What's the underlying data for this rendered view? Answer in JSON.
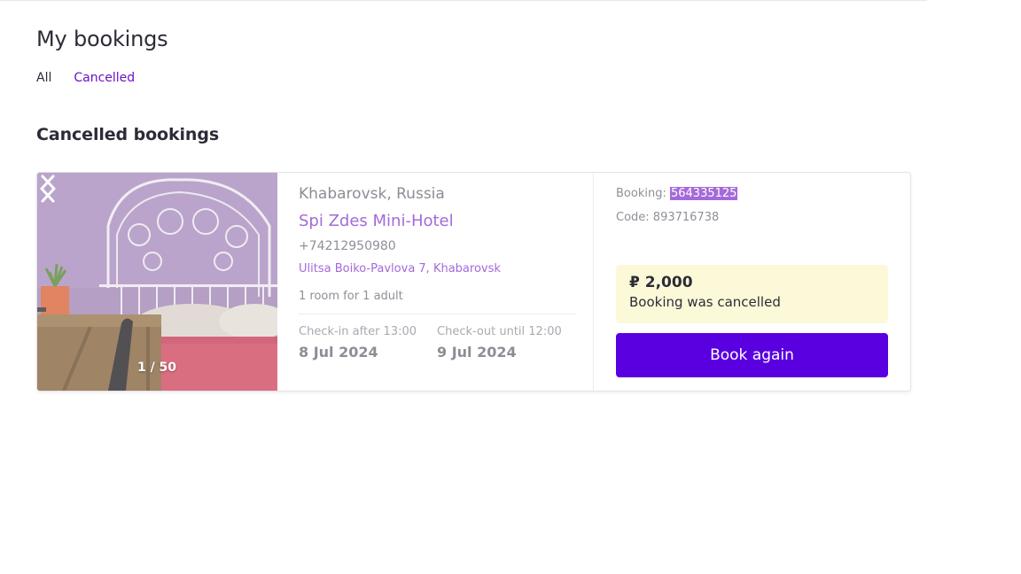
{
  "page": {
    "title": "My bookings",
    "tabs": [
      {
        "label": "All",
        "active": false
      },
      {
        "label": "Cancelled",
        "active": true
      }
    ],
    "section_title": "Cancelled bookings"
  },
  "booking": {
    "photo": {
      "counter": "1 / 50",
      "prev_icon": "chevron-left-icon",
      "next_icon": "chevron-right-icon"
    },
    "city": "Khabarovsk, Russia",
    "hotel_name": "Spi Zdes Mini-Hotel",
    "phone": "+74212950980",
    "address": "Ulitsa Boiko-Pavlova 7, Khabarovsk",
    "room": "1 room for 1 adult",
    "checkin_label": "Check-in after 13:00",
    "checkin_date": "8 Jul 2024",
    "checkout_label": "Check-out until 12:00",
    "checkout_date": "9 Jul 2024",
    "booking_label": "Booking: ",
    "booking_number": "564335125",
    "code_label": "Code: ",
    "code_value": "893716738",
    "price": "₽ 2,000",
    "status": "Booking was cancelled",
    "book_again_label": "Book again"
  },
  "colors": {
    "accent": "#6b10c9",
    "button": "#5a00e0",
    "link_faded": "#a46ad9",
    "status_bg": "#fcf9d8"
  }
}
